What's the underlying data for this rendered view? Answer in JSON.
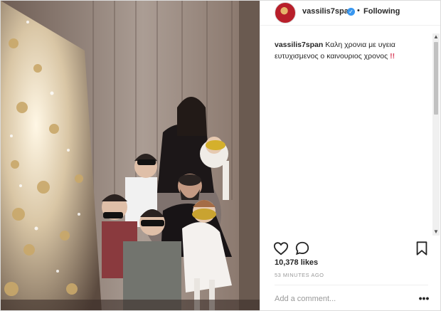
{
  "post": {
    "username": "vassilis7span",
    "verified_icon": "verified-badge-icon",
    "separator": "•",
    "follow_status": "Following"
  },
  "caption": {
    "username": "vassilis7span",
    "text": "Καλη χρονια με υγεια ευτυχισμενος ο καινουριος χρονος",
    "emphasis": "!!"
  },
  "actions": {
    "like_icon": "heart-icon",
    "comment_icon": "comment-icon",
    "save_icon": "bookmark-icon"
  },
  "stats": {
    "likes": "10,378 likes",
    "time_ago": "53 MINUTES AGO"
  },
  "comment": {
    "placeholder": "Add a comment...",
    "more": "•••"
  },
  "colors": {
    "verified": "#3897f0",
    "emphasis": "#d9435f",
    "muted": "#999999"
  }
}
